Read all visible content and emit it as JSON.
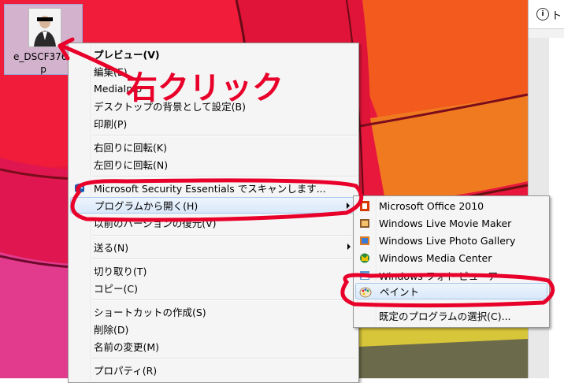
{
  "desktop_icon": {
    "label_line1": "e_DSCF3767",
    "label_line2": "p"
  },
  "side_window": {
    "title": "ト",
    "icon": "info-icon"
  },
  "annotation": {
    "text": "右クリック",
    "color": "#e8002a"
  },
  "context_menu": {
    "items": [
      {
        "label": "プレビュー(V)",
        "bold": true
      },
      {
        "label": "編集(E)"
      },
      {
        "label": "MediaInfo"
      },
      {
        "label": "デスクトップの背景として設定(B)"
      },
      {
        "label": "印刷(P)"
      },
      {
        "label": "右回りに回転(K)"
      },
      {
        "label": "左回りに回転(N)"
      },
      {
        "label": "Microsoft Security Essentials でスキャンします..."
      },
      {
        "label": "プログラムから開く(H)",
        "submenu": true
      },
      {
        "label": "以前のバージョンの復元(V)"
      },
      {
        "label": "送る(N)",
        "submenu": true
      },
      {
        "label": "切り取り(T)"
      },
      {
        "label": "コピー(C)"
      },
      {
        "label": "ショートカットの作成(S)"
      },
      {
        "label": "削除(D)"
      },
      {
        "label": "名前の変更(M)"
      },
      {
        "label": "プロパティ(R)"
      }
    ]
  },
  "submenu": {
    "items": [
      {
        "label": "Microsoft Office 2010",
        "icon": "office-icon"
      },
      {
        "label": "Windows Live Movie Maker",
        "icon": "movie-maker-icon"
      },
      {
        "label": "Windows Live Photo Gallery",
        "icon": "photo-gallery-icon"
      },
      {
        "label": "Windows Media Center",
        "icon": "media-center-icon"
      },
      {
        "label": "Windows フォト ビューアー",
        "icon": "photo-viewer-icon"
      },
      {
        "label": "ペイント",
        "icon": "paint-icon"
      },
      {
        "label": "既定のプログラムの選択(C)..."
      }
    ]
  },
  "colors": {
    "menu_bg": "#f5f5f5",
    "hover_border": "#a9c9f0",
    "annotation_red": "#e8002a"
  }
}
